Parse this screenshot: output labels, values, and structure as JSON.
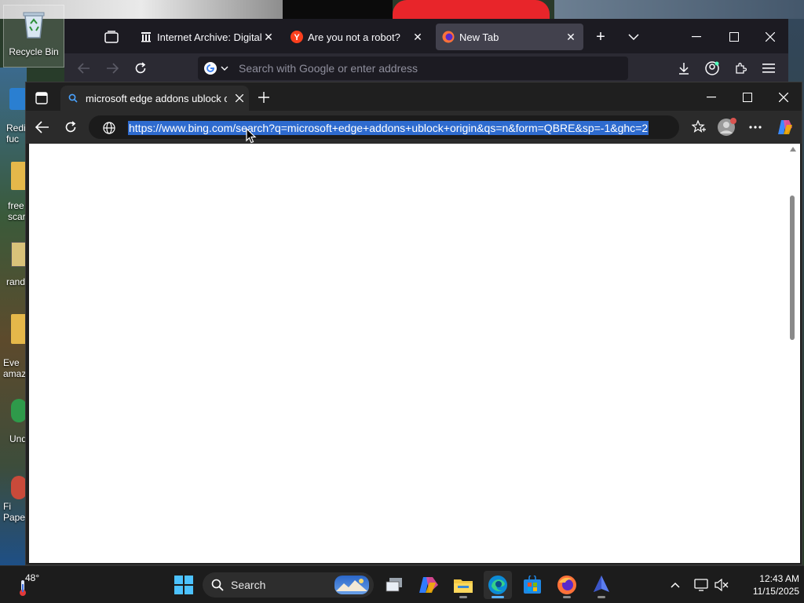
{
  "desktop": {
    "icons": [
      {
        "label": "Recycle Bin",
        "icon": "recycle-bin-icon"
      },
      {
        "label": "Redi\nfuc",
        "icon": "app-shortcut-icon"
      },
      {
        "label": "free\nscar",
        "icon": "folder-icon"
      },
      {
        "label": "rand",
        "icon": "document-icon"
      },
      {
        "label": "Eve\namaz",
        "icon": "app-shortcut-icon"
      },
      {
        "label": "Und",
        "icon": "app-shortcut-icon"
      },
      {
        "label": "Fi\nPape",
        "icon": "app-shortcut-icon"
      }
    ]
  },
  "firefox": {
    "tabs": [
      {
        "label": "Internet Archive: Digital Li",
        "icon": "archive-icon",
        "active": false
      },
      {
        "label": "Are you not a robot?",
        "icon": "yandex-icon",
        "active": false
      },
      {
        "label": "New Tab",
        "icon": "firefox-icon",
        "active": true
      }
    ],
    "url_placeholder": "Search with Google or enter address"
  },
  "edge": {
    "tab_title": "microsoft edge addons ublock or",
    "url": "https://www.bing.com/search?q=microsoft+edge+addons+ublock+origin&qs=n&form=QBRE&sp=-1&ghc=2"
  },
  "taskbar": {
    "weather_temp": "48°",
    "search_label": "Search",
    "time": "12:43 AM",
    "date": "11/15/2025",
    "apps": [
      "task-view",
      "copilot",
      "file-explorer",
      "edge",
      "microsoft-store",
      "firefox",
      "app"
    ]
  },
  "colors": {
    "edge_selection": "#2e6bcf",
    "taskbar_bg": "#1c1c1c",
    "firefox_bg": "#1c1b22"
  }
}
